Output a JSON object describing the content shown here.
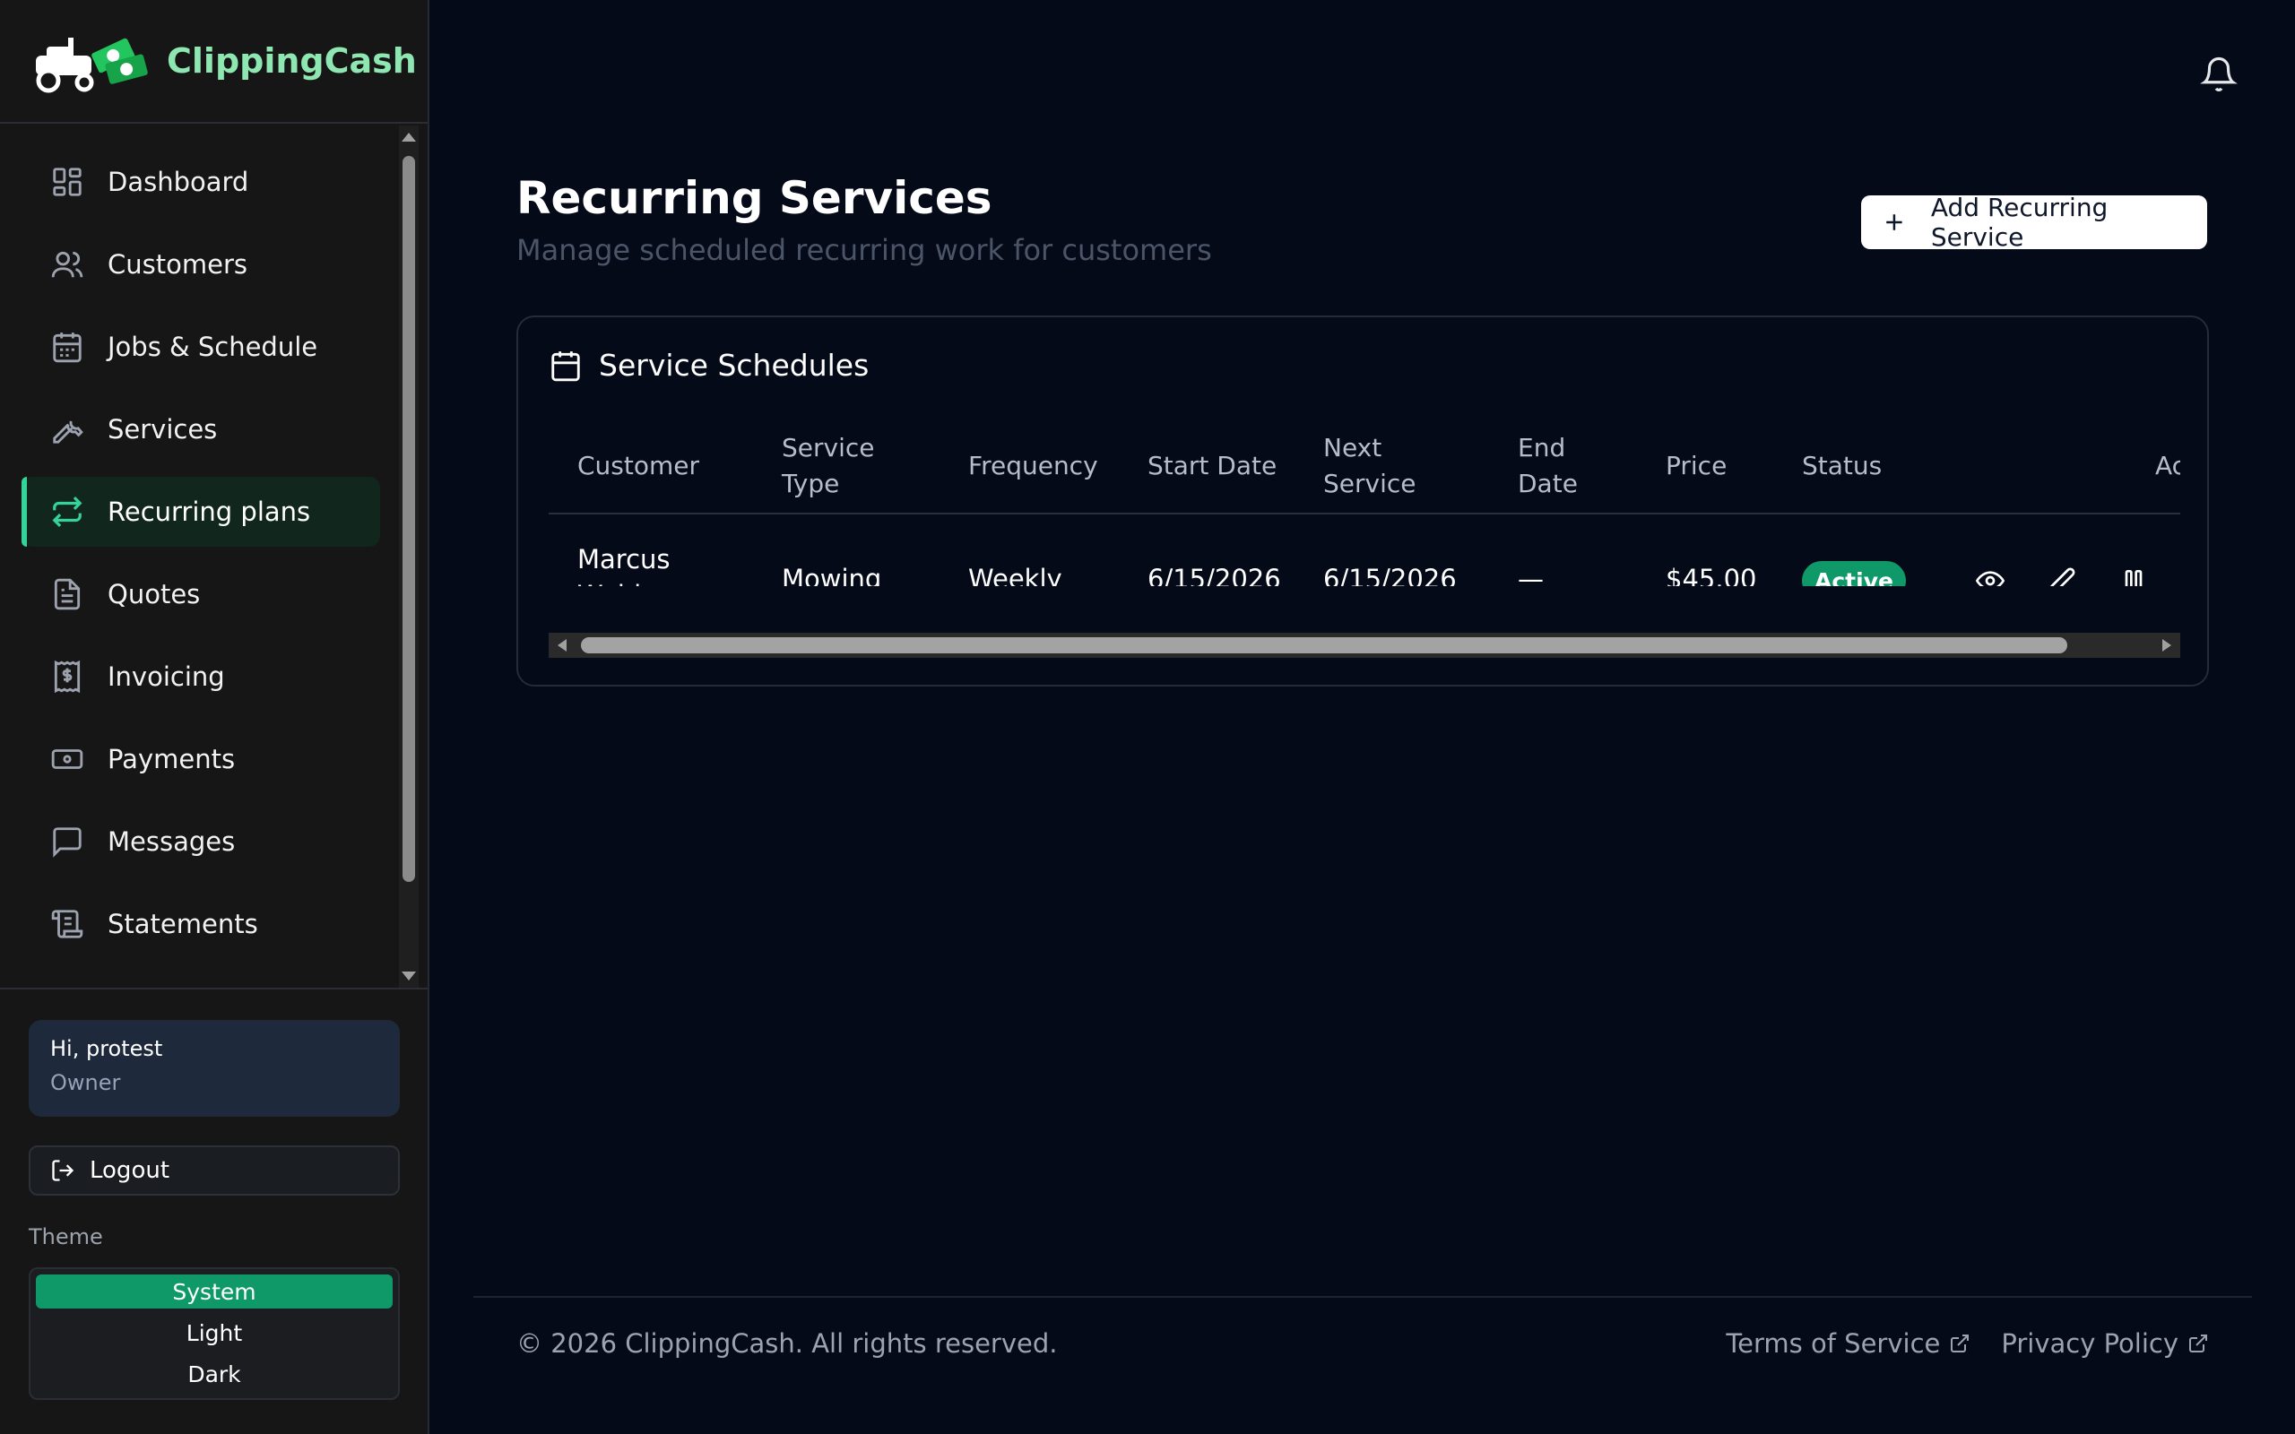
{
  "brand": {
    "name": "ClippingCash"
  },
  "sidebar": {
    "items": [
      {
        "label": "Dashboard",
        "icon": "dashboard-icon"
      },
      {
        "label": "Customers",
        "icon": "users-icon"
      },
      {
        "label": "Jobs & Schedule",
        "icon": "calendar-icon"
      },
      {
        "label": "Services",
        "icon": "wrench-icon"
      },
      {
        "label": "Recurring plans",
        "icon": "repeat-icon",
        "active": true
      },
      {
        "label": "Quotes",
        "icon": "document-icon"
      },
      {
        "label": "Invoicing",
        "icon": "receipt-icon"
      },
      {
        "label": "Payments",
        "icon": "banknote-icon"
      },
      {
        "label": "Messages",
        "icon": "message-icon"
      },
      {
        "label": "Statements",
        "icon": "scroll-icon"
      }
    ],
    "user": {
      "greeting": "Hi, protest",
      "role": "Owner"
    },
    "logout_label": "Logout",
    "theme": {
      "label": "Theme",
      "options": [
        "System",
        "Light",
        "Dark"
      ],
      "selected": "System"
    }
  },
  "main": {
    "title": "Recurring Services",
    "subtitle": "Manage scheduled recurring work for customers",
    "add_button_label": "Add Recurring Service",
    "card_title": "Service Schedules",
    "columns": [
      "Customer",
      "Service Type",
      "Frequency",
      "Start Date",
      "Next Service",
      "End Date",
      "Price",
      "Status",
      "Ac"
    ],
    "rows": [
      {
        "customer": "Marcus Webb",
        "service_type": "Mowing",
        "frequency": "Weekly",
        "start_date": "6/15/2026",
        "next_service": "6/15/2026",
        "end_date": "—",
        "price": "$45.00",
        "status": "Active"
      }
    ]
  },
  "footer": {
    "copyright": "© 2026 ClippingCash. All rights reserved.",
    "links": [
      "Terms of Service",
      "Privacy Policy"
    ]
  },
  "colors": {
    "accent": "#34d399",
    "status_active": "#0f9968",
    "background": "#050a18",
    "sidebar": "#161616"
  }
}
